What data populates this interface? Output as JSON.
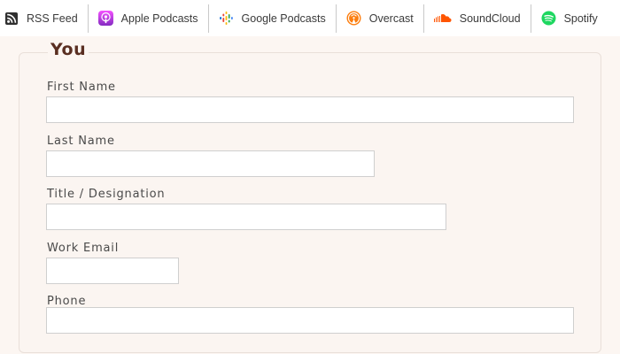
{
  "podcast_bar": {
    "links": [
      {
        "label": "RSS Feed",
        "icon": "rss-icon",
        "color": "#333333"
      },
      {
        "label": "Apple Podcasts",
        "icon": "apple-podcasts-icon",
        "color": "#b150e2"
      },
      {
        "label": "Google Podcasts",
        "icon": "google-podcasts-icon",
        "color": "#4285f4"
      },
      {
        "label": "Overcast",
        "icon": "overcast-icon",
        "color": "#fc7e0f"
      },
      {
        "label": "SoundCloud",
        "icon": "soundcloud-icon",
        "color": "#ff5500"
      },
      {
        "label": "Spotify",
        "icon": "spotify-icon",
        "color": "#1ed760"
      }
    ]
  },
  "form": {
    "section_title": "You",
    "fields": [
      {
        "label": "First Name",
        "value": "",
        "placeholder": ""
      },
      {
        "label": "Last Name",
        "value": "",
        "placeholder": ""
      },
      {
        "label": "Title / Designation",
        "value": "",
        "placeholder": ""
      },
      {
        "label": "Work Email",
        "value": "",
        "placeholder": ""
      },
      {
        "label": "Phone",
        "value": "",
        "placeholder": ""
      }
    ]
  },
  "colors": {
    "page_background": "#fcf6f2",
    "section_title": "#5a2f22",
    "input_border": "#cfcfcf"
  }
}
